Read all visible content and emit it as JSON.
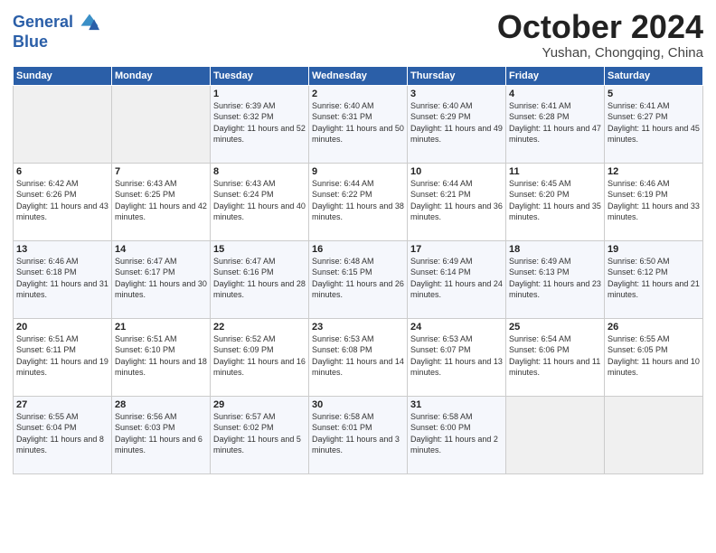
{
  "header": {
    "logo_line1": "General",
    "logo_line2": "Blue",
    "month": "October 2024",
    "location": "Yushan, Chongqing, China"
  },
  "weekdays": [
    "Sunday",
    "Monday",
    "Tuesday",
    "Wednesday",
    "Thursday",
    "Friday",
    "Saturday"
  ],
  "weeks": [
    [
      {
        "day": "",
        "empty": true
      },
      {
        "day": "",
        "empty": true
      },
      {
        "day": "1",
        "sunrise": "6:39 AM",
        "sunset": "6:32 PM",
        "daylight": "11 hours and 52 minutes."
      },
      {
        "day": "2",
        "sunrise": "6:40 AM",
        "sunset": "6:31 PM",
        "daylight": "11 hours and 50 minutes."
      },
      {
        "day": "3",
        "sunrise": "6:40 AM",
        "sunset": "6:29 PM",
        "daylight": "11 hours and 49 minutes."
      },
      {
        "day": "4",
        "sunrise": "6:41 AM",
        "sunset": "6:28 PM",
        "daylight": "11 hours and 47 minutes."
      },
      {
        "day": "5",
        "sunrise": "6:41 AM",
        "sunset": "6:27 PM",
        "daylight": "11 hours and 45 minutes."
      }
    ],
    [
      {
        "day": "6",
        "sunrise": "6:42 AM",
        "sunset": "6:26 PM",
        "daylight": "11 hours and 43 minutes."
      },
      {
        "day": "7",
        "sunrise": "6:43 AM",
        "sunset": "6:25 PM",
        "daylight": "11 hours and 42 minutes."
      },
      {
        "day": "8",
        "sunrise": "6:43 AM",
        "sunset": "6:24 PM",
        "daylight": "11 hours and 40 minutes."
      },
      {
        "day": "9",
        "sunrise": "6:44 AM",
        "sunset": "6:22 PM",
        "daylight": "11 hours and 38 minutes."
      },
      {
        "day": "10",
        "sunrise": "6:44 AM",
        "sunset": "6:21 PM",
        "daylight": "11 hours and 36 minutes."
      },
      {
        "day": "11",
        "sunrise": "6:45 AM",
        "sunset": "6:20 PM",
        "daylight": "11 hours and 35 minutes."
      },
      {
        "day": "12",
        "sunrise": "6:46 AM",
        "sunset": "6:19 PM",
        "daylight": "11 hours and 33 minutes."
      }
    ],
    [
      {
        "day": "13",
        "sunrise": "6:46 AM",
        "sunset": "6:18 PM",
        "daylight": "11 hours and 31 minutes."
      },
      {
        "day": "14",
        "sunrise": "6:47 AM",
        "sunset": "6:17 PM",
        "daylight": "11 hours and 30 minutes."
      },
      {
        "day": "15",
        "sunrise": "6:47 AM",
        "sunset": "6:16 PM",
        "daylight": "11 hours and 28 minutes."
      },
      {
        "day": "16",
        "sunrise": "6:48 AM",
        "sunset": "6:15 PM",
        "daylight": "11 hours and 26 minutes."
      },
      {
        "day": "17",
        "sunrise": "6:49 AM",
        "sunset": "6:14 PM",
        "daylight": "11 hours and 24 minutes."
      },
      {
        "day": "18",
        "sunrise": "6:49 AM",
        "sunset": "6:13 PM",
        "daylight": "11 hours and 23 minutes."
      },
      {
        "day": "19",
        "sunrise": "6:50 AM",
        "sunset": "6:12 PM",
        "daylight": "11 hours and 21 minutes."
      }
    ],
    [
      {
        "day": "20",
        "sunrise": "6:51 AM",
        "sunset": "6:11 PM",
        "daylight": "11 hours and 19 minutes."
      },
      {
        "day": "21",
        "sunrise": "6:51 AM",
        "sunset": "6:10 PM",
        "daylight": "11 hours and 18 minutes."
      },
      {
        "day": "22",
        "sunrise": "6:52 AM",
        "sunset": "6:09 PM",
        "daylight": "11 hours and 16 minutes."
      },
      {
        "day": "23",
        "sunrise": "6:53 AM",
        "sunset": "6:08 PM",
        "daylight": "11 hours and 14 minutes."
      },
      {
        "day": "24",
        "sunrise": "6:53 AM",
        "sunset": "6:07 PM",
        "daylight": "11 hours and 13 minutes."
      },
      {
        "day": "25",
        "sunrise": "6:54 AM",
        "sunset": "6:06 PM",
        "daylight": "11 hours and 11 minutes."
      },
      {
        "day": "26",
        "sunrise": "6:55 AM",
        "sunset": "6:05 PM",
        "daylight": "11 hours and 10 minutes."
      }
    ],
    [
      {
        "day": "27",
        "sunrise": "6:55 AM",
        "sunset": "6:04 PM",
        "daylight": "11 hours and 8 minutes."
      },
      {
        "day": "28",
        "sunrise": "6:56 AM",
        "sunset": "6:03 PM",
        "daylight": "11 hours and 6 minutes."
      },
      {
        "day": "29",
        "sunrise": "6:57 AM",
        "sunset": "6:02 PM",
        "daylight": "11 hours and 5 minutes."
      },
      {
        "day": "30",
        "sunrise": "6:58 AM",
        "sunset": "6:01 PM",
        "daylight": "11 hours and 3 minutes."
      },
      {
        "day": "31",
        "sunrise": "6:58 AM",
        "sunset": "6:00 PM",
        "daylight": "11 hours and 2 minutes."
      },
      {
        "day": "",
        "empty": true
      },
      {
        "day": "",
        "empty": true
      }
    ]
  ]
}
